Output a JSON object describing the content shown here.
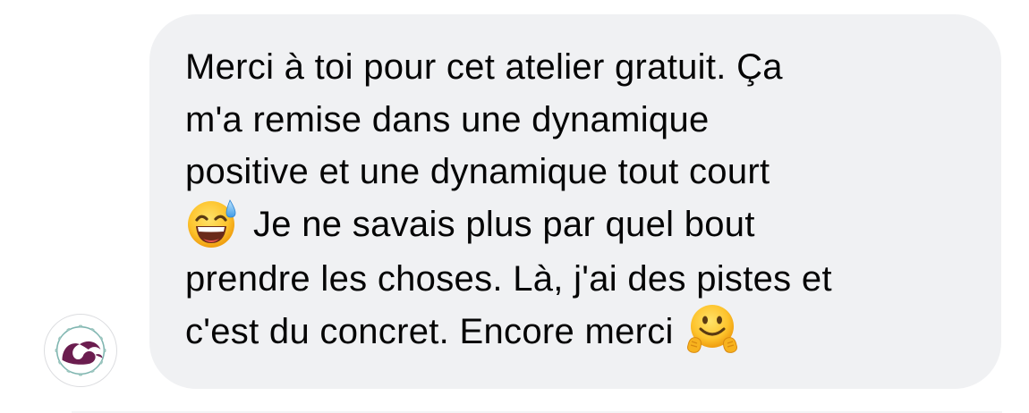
{
  "message": {
    "lines": [
      "Merci à toi pour cet atelier gratuit. Ça",
      "m'a remise dans une dynamique",
      "positive et une dynamique tout court",
      "Je ne savais plus par quel bout",
      "prendre les choses. Là, j'ai des pistes et",
      "c'est du concret. Encore merci"
    ],
    "emojis": {
      "line4_start": "sweat-smile-emoji",
      "line6_end": "hugging-face-emoji"
    }
  },
  "sender": {
    "avatar_icon": "wave-logo-icon"
  },
  "colors": {
    "bubble_background": "#f0f1f3",
    "text": "#050505",
    "logo_primary": "#6b1d4f",
    "logo_ring": "#7fb5b0"
  }
}
